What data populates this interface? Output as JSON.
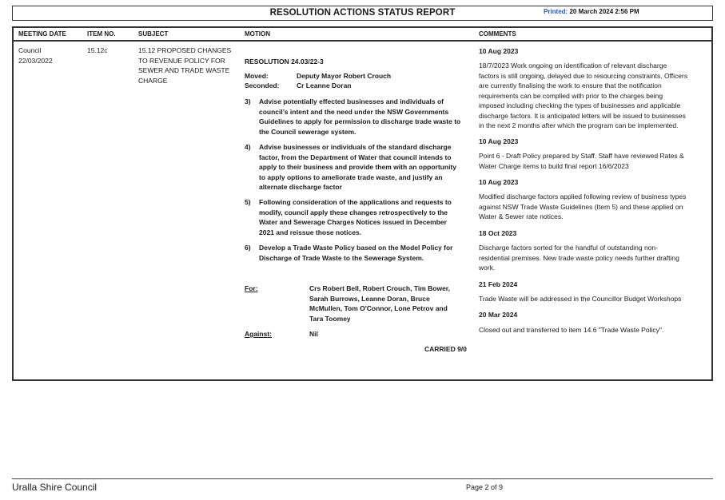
{
  "header": {
    "title": "RESOLUTION ACTIONS STATUS REPORT",
    "printed_label": "Printed:",
    "printed_value": "20 March 2024 2:56 PM"
  },
  "columns": {
    "meeting_date": "MEETING DATE",
    "item_no": "ITEM NO.",
    "subject": "SUBJECT",
    "motion": "MOTION",
    "comments": "COMMENTS"
  },
  "row": {
    "meeting_line1": "Council",
    "meeting_line2": "22/03/2022",
    "item_no": "15.12c",
    "subject_lines": [
      "15.12 PROPOSED CHANGES",
      "TO REVENUE POLICY FOR",
      "SEWER AND TRADE WASTE",
      "CHARGE"
    ],
    "motion": {
      "resolution": "RESOLUTION 24.03/22-3",
      "moved_label": "Moved:",
      "moved_value": "Deputy Mayor Robert Crouch",
      "seconded_label": "Seconded:",
      "seconded_value": "Cr Leanne Doran",
      "items": [
        {
          "num": "3)",
          "lines": [
            "Advise potentially effected businesses and individuals of",
            "council’s intent and the need under the NSW Governments",
            "Guidelines to apply for permission to discharge trade waste to",
            "the Council sewerage system."
          ]
        },
        {
          "num": "4)",
          "lines": [
            "Advise businesses or individuals of the standard discharge",
            "factor, from the Department of Water that council intends to",
            "apply to their business and provide them with an opportunity",
            "to apply options to ameliorate trade waste, and justify an",
            "alternate discharge factor"
          ]
        },
        {
          "num": "5)",
          "lines": [
            "Following consideration of the applications and requests to",
            "modify, council apply these changes retrospectively to the",
            "Water and Sewerage Charges Notices issued in December",
            "2021 and reissue those notices."
          ]
        },
        {
          "num": "6)",
          "lines": [
            "Develop a Trade Waste Policy based on the Model Policy for",
            "Discharge of Trade Waste to the Sewerage System."
          ]
        }
      ],
      "for_label": "For:",
      "for_lines": [
        "Crs Robert Bell, Robert Crouch, Tim Bower,",
        "Sarah Burrows, Leanne Doran, Bruce",
        "McMullen, Tom O'Connor, Lone Petrov and",
        "Tara Toomey"
      ],
      "against_label": "Against:",
      "against_value": "Nil",
      "carried": "CARRIED 9/0"
    },
    "comments": [
      {
        "date": "10 Aug 2023",
        "lines": [
          "18/7/2023 Work ongoing on identification of relevant discharge",
          "factors is still ongoing, delayed due to resourcing constraints.  Officers",
          "are currently finalising the work to ensure that the notification",
          "requirements can be complied with prior to the charges being",
          "imposed including checking the types of businesses and applicable",
          "discharge factors. It is anticipated letters will be issued to businesses",
          "in the next 2 months after which the program can be implemented."
        ]
      },
      {
        "date": "10 Aug 2023",
        "lines": [
          "Point 6 - Draft Policy prepared by Staff. Staff have reviewed Rates &",
          "Water Charge items to build final report 16/6/2023"
        ]
      },
      {
        "date": "10 Aug 2023",
        "lines": [
          "Modified discharge factors applied following review of business types",
          "against NSW Trade Waste Guidelines (Item 5) and these applied on",
          "Water & Sewer rate notices."
        ]
      },
      {
        "date": "18 Oct 2023",
        "lines": [
          "Discharge factors sorted for the handful of outstanding non-",
          "residential premises.  New trade waste policy needs further drafting",
          "work."
        ]
      },
      {
        "date": "21 Feb 2024",
        "lines": [
          "Trade Waste will be addressed in the Councillor Budget Workshops"
        ]
      },
      {
        "date": "20 Mar 2024",
        "lines": [
          "Closed out and transferred to item 14.6 \"Trade Waste Policy\"."
        ]
      }
    ]
  },
  "footer": {
    "council": "Uralla Shire Council",
    "page": "Page 2 of 9"
  }
}
